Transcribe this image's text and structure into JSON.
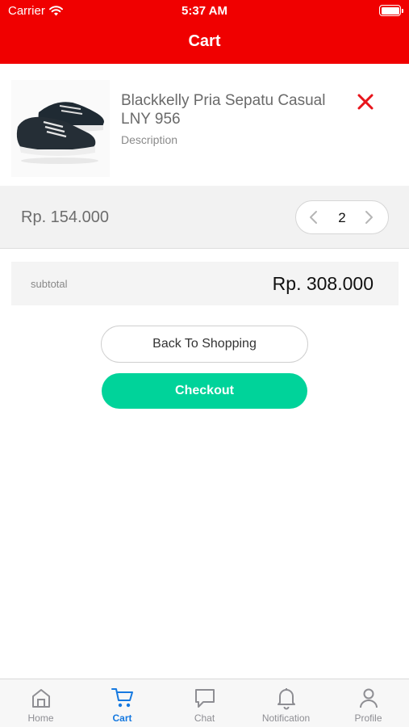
{
  "status_bar": {
    "carrier": "Carrier",
    "time": "5:37 AM"
  },
  "header": {
    "title": "Cart"
  },
  "cart": {
    "item": {
      "name": "Blackkelly Pria Sepatu Casual LNY 956",
      "description": "Description",
      "unit_price": "Rp. 154.000",
      "quantity": "2",
      "image": "black-canvas-sneakers-image",
      "remove_icon": "close-icon"
    },
    "subtotal_label": "subtotal",
    "subtotal_value": "Rp. 308.000"
  },
  "actions": {
    "back_label": "Back To Shopping",
    "checkout_label": "Checkout"
  },
  "tab_bar": {
    "items": [
      {
        "label": "Home",
        "icon": "home-icon",
        "active": false
      },
      {
        "label": "Cart",
        "icon": "cart-icon",
        "active": true
      },
      {
        "label": "Chat",
        "icon": "chat-icon",
        "active": false
      },
      {
        "label": "Notification",
        "icon": "bell-icon",
        "active": false
      },
      {
        "label": "Profile",
        "icon": "user-icon",
        "active": false
      }
    ]
  },
  "colors": {
    "header_bg": "#f00000",
    "checkout_bg": "#00d39a",
    "remove_icon": "#e8141b",
    "tab_active": "#1679e0",
    "tab_inactive": "#8e8e93"
  }
}
